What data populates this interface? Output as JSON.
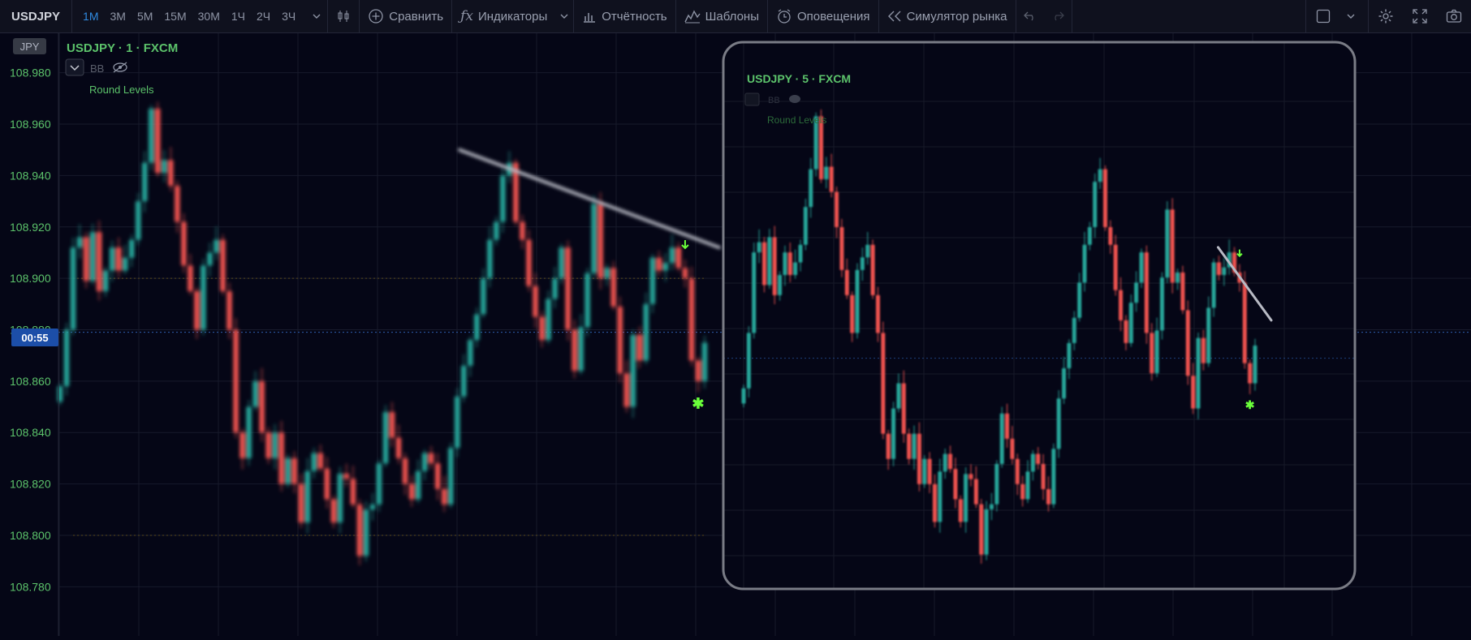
{
  "toolbar": {
    "symbol": "USDJPY",
    "timeframes": [
      "1М",
      "3М",
      "5М",
      "15М",
      "30М",
      "1Ч",
      "2Ч",
      "3Ч"
    ],
    "active_timeframe": "1М",
    "compare_label": "Сравнить",
    "indicators_label": "Индикаторы",
    "reports_label": "Отчётность",
    "templates_label": "Шаблоны",
    "alerts_label": "Оповещения",
    "simulator_label": "Симулятор рынка"
  },
  "legend": {
    "title": "USDJPY · 1 · FXCM",
    "bb_label": "BB",
    "indicator_label": "Round Levels"
  },
  "currency_badge": "JPY",
  "price_badge": "00:55",
  "inset": {
    "title": "USDJPY · 5 · FXCM",
    "bb_label": "BB",
    "indicator_label": "Round Levels"
  },
  "colors": {
    "up": "#26a69a",
    "down": "#ef5350",
    "accent": "#2f8ae0",
    "legend_green": "#5cc36b",
    "signal_green": "#6aff3a"
  },
  "chart_data": {
    "type": "candlestick",
    "ylim": [
      108.77,
      108.99
    ],
    "yticks": [
      108.98,
      108.96,
      108.94,
      108.92,
      108.9,
      108.88,
      108.86,
      108.84,
      108.82,
      108.8,
      108.78
    ],
    "ytick_labels": [
      "108.980",
      "108.960",
      "108.940",
      "108.920",
      "108.900",
      "108.880",
      "108.860",
      "108.840",
      "108.820",
      "108.800",
      "108.780"
    ],
    "round_levels": [
      108.9,
      108.8
    ],
    "current_price": 108.879,
    "trendline": {
      "from": [
        0,
        108.95
      ],
      "to": [
        99,
        108.912
      ]
    },
    "signal_arrow_index": 96,
    "signal_star_index": 98,
    "close": [
      108.858,
      108.88,
      108.912,
      108.916,
      108.899,
      108.918,
      108.895,
      108.903,
      108.912,
      108.903,
      108.908,
      108.915,
      108.93,
      108.945,
      108.966,
      108.941,
      108.946,
      108.936,
      108.922,
      108.905,
      108.895,
      108.88,
      108.905,
      108.91,
      108.915,
      108.895,
      108.88,
      108.84,
      108.83,
      108.85,
      108.86,
      108.84,
      108.83,
      108.84,
      108.82,
      108.83,
      108.82,
      108.805,
      108.825,
      108.832,
      108.826,
      108.814,
      108.805,
      108.824,
      108.822,
      108.812,
      108.792,
      108.81,
      108.812,
      108.828,
      108.848,
      108.838,
      108.83,
      108.82,
      108.814,
      108.825,
      108.832,
      108.828,
      108.818,
      108.812,
      108.834,
      108.854,
      108.866,
      108.876,
      108.886,
      108.9,
      108.915,
      108.922,
      108.94,
      108.945,
      108.922,
      108.915,
      108.897,
      108.885,
      108.876,
      108.892,
      108.9,
      108.912,
      108.88,
      108.864,
      108.881,
      108.902,
      108.929,
      108.9,
      108.904,
      108.889,
      108.863,
      108.85,
      108.878,
      108.868,
      108.89,
      108.908,
      108.903,
      108.906,
      108.912,
      108.904,
      108.9,
      108.868,
      108.86,
      108.875
    ]
  }
}
